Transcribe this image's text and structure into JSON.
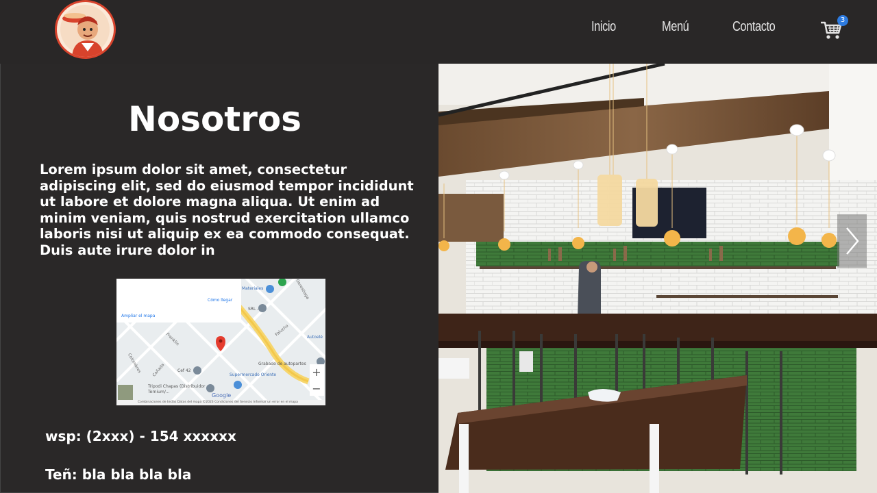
{
  "header": {
    "nav": [
      {
        "label": "Inicio"
      },
      {
        "label": "Menú"
      },
      {
        "label": "Contacto"
      }
    ],
    "cart_count": "3",
    "icons": {
      "logo": "chef-logo",
      "cart": "shopping-cart-icon"
    }
  },
  "about": {
    "title": "Nosotros",
    "description": "Lorem ipsum dolor sit amet, consectetur adipiscing elit, sed do eiusmod tempor incididunt ut labore et dolore magna aliqua. Ut enim ad minim veniam, quis nostrud exercitation ullamco laboris nisi ut aliquip ex ea commodo consequat. Duis aute irure dolor in",
    "map": {
      "expand_link": "Ampliar el mapa",
      "directions": "Cómo llegar",
      "places": [
        "Materiales",
        "Franklin",
        "Cef 42",
        "Tripodi Chapas (Distribuidor Ternium/...",
        "Supermercado Oriente",
        "Grabado de autopartes",
        "Autoelé",
        "Gorostiaga",
        "Colombres",
        "Falucho",
        "Cañada",
        "SRL -"
      ],
      "footer": "Combinaciones de teclas   Datos del mapa ©2023   Condiciones del Servicio   Informar un error en el mapa",
      "brand": "Google"
    },
    "phone": "wsp: (2xxx) - 154 xxxxxx",
    "tel": "Teñ: bla bla bla bla"
  },
  "colors": {
    "background": "#2a2828",
    "accent_logo": "#d8432c",
    "badge": "#2d7be0"
  }
}
